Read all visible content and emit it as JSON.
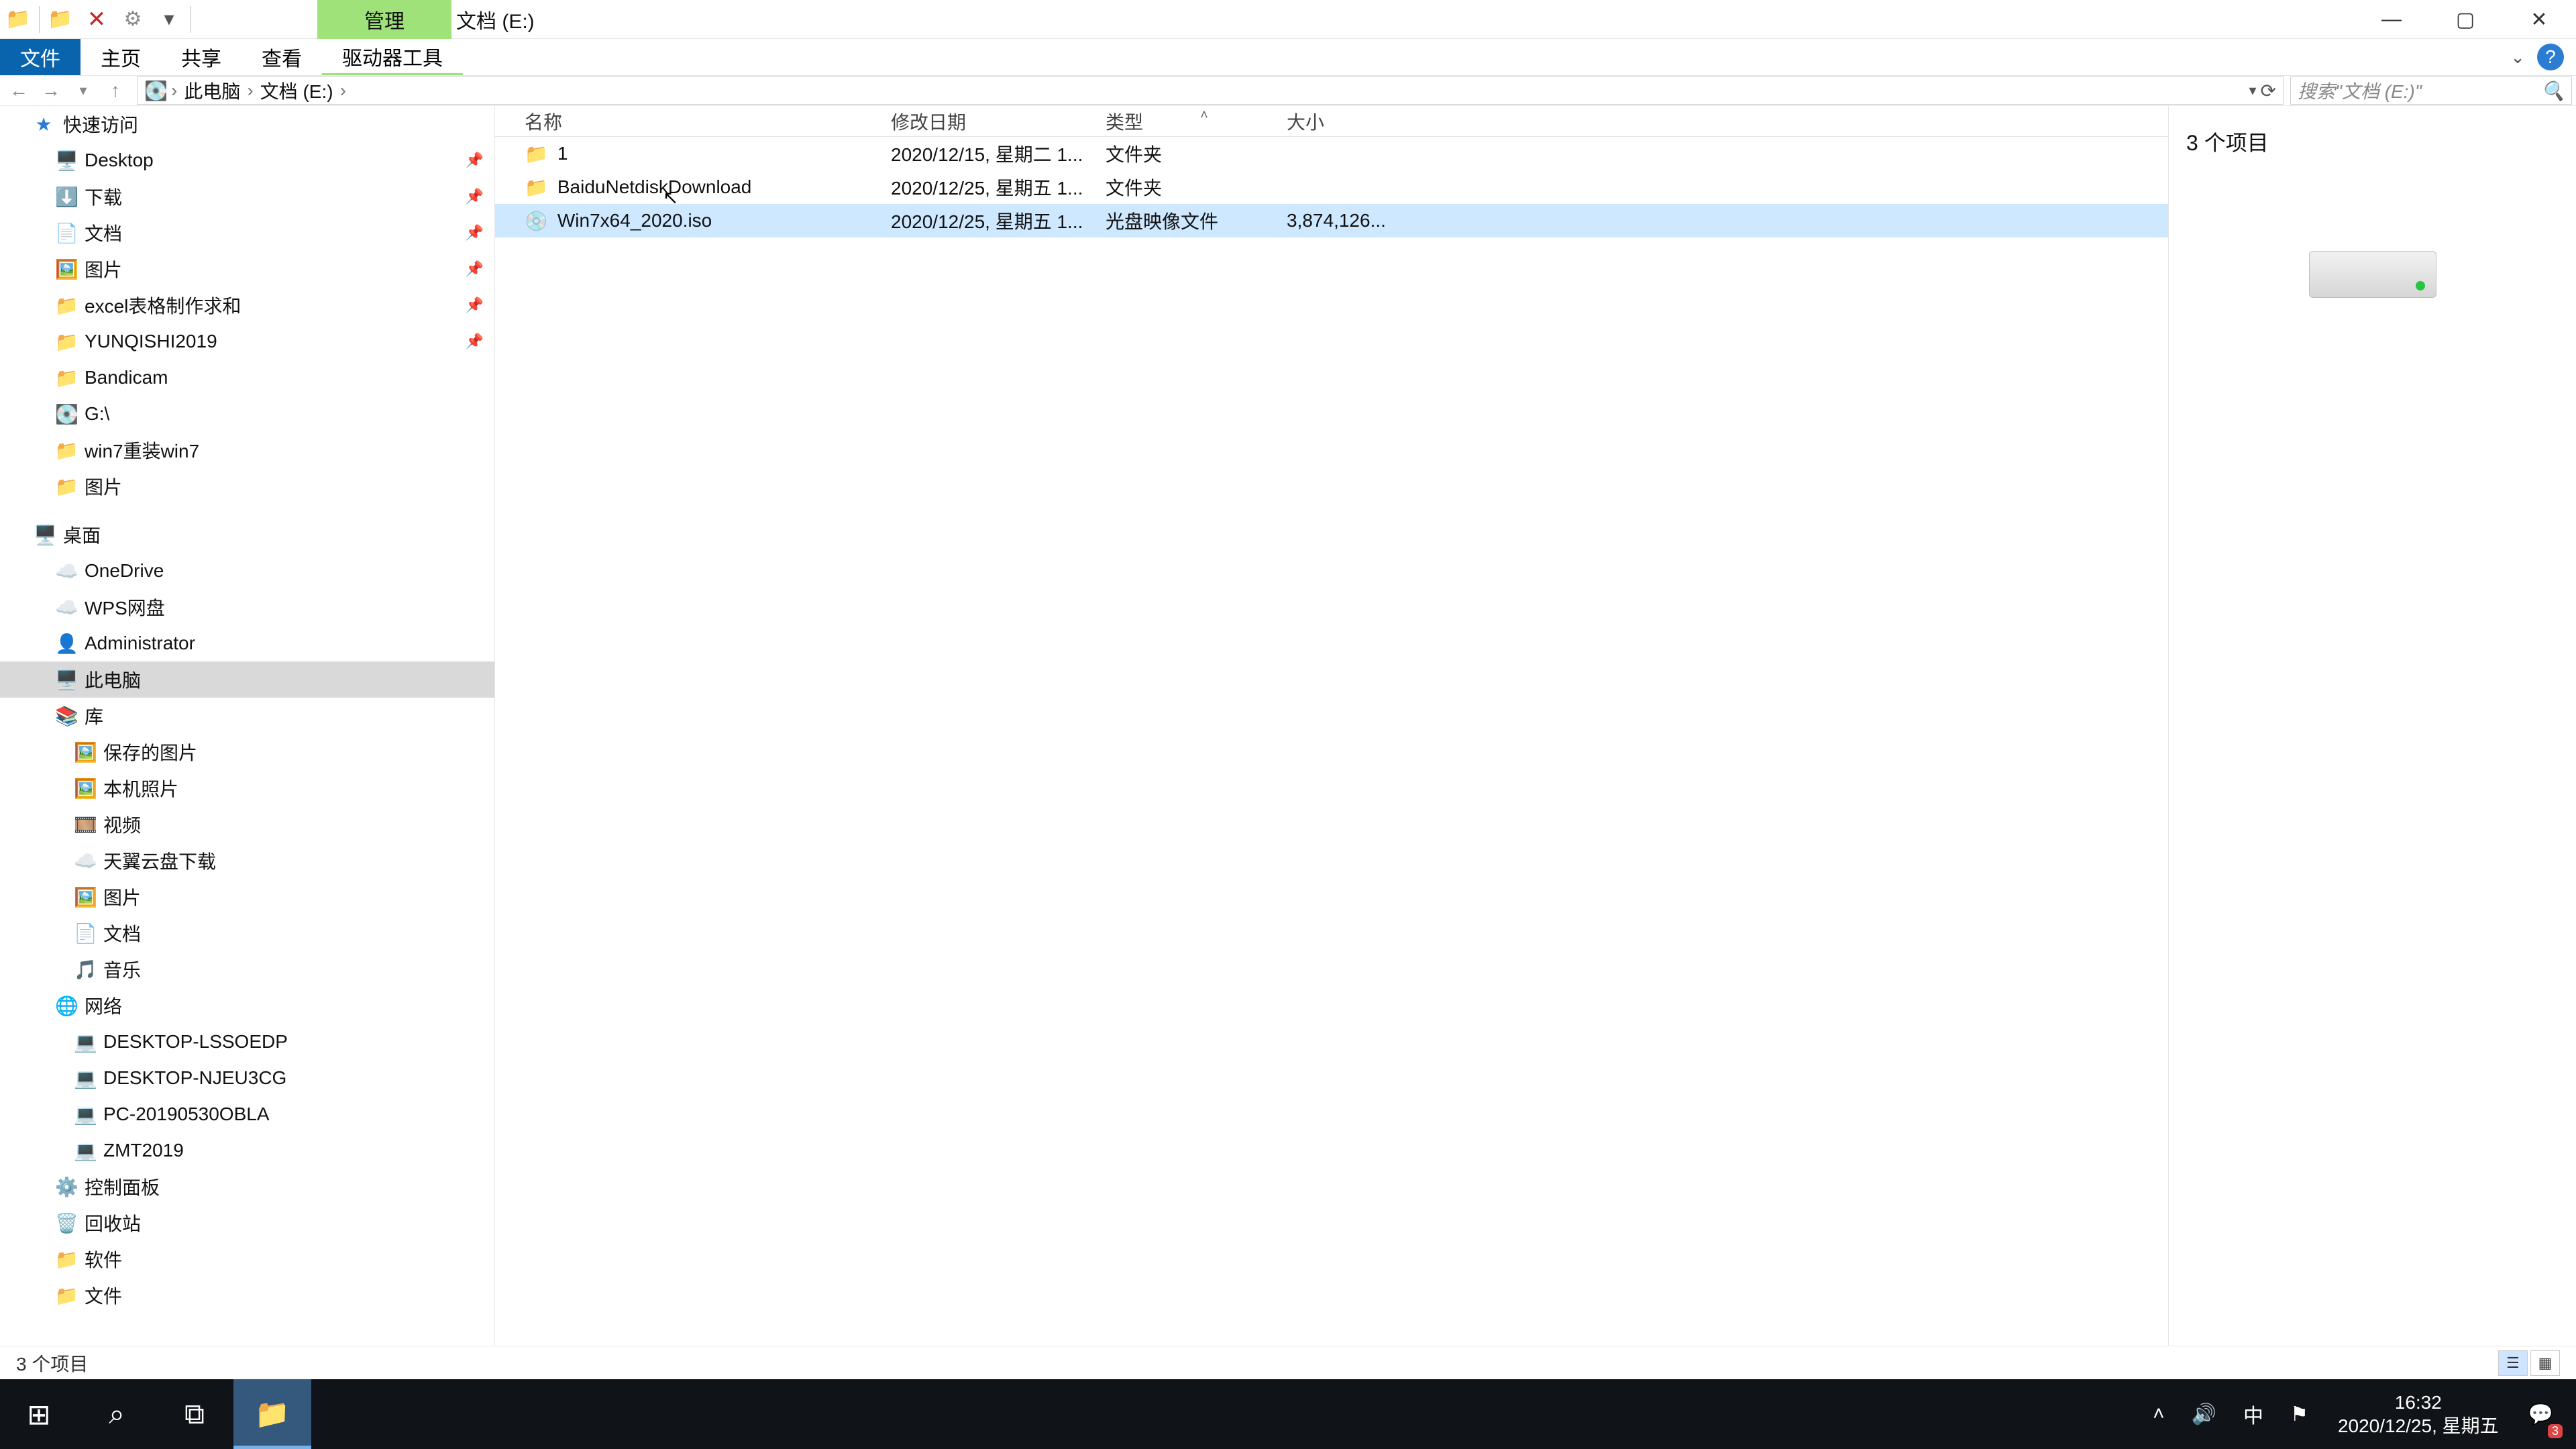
{
  "title": {
    "manage_tab": "管理",
    "location": "文档 (E:)"
  },
  "tabs": {
    "file": "文件",
    "home": "主页",
    "share": "共享",
    "view": "查看",
    "driver_tools": "驱动器工具"
  },
  "breadcrumb": {
    "root": "此电脑",
    "curr": "文档 (E:)"
  },
  "search_placeholder": "搜索\"文档 (E:)\"",
  "columns": {
    "name": "名称",
    "modified": "修改日期",
    "type": "类型",
    "size": "大小"
  },
  "files": [
    {
      "name": "1",
      "modified": "2020/12/15, 星期二 1...",
      "type": "文件夹",
      "size": "",
      "icon": "folder"
    },
    {
      "name": "BaiduNetdiskDownload",
      "modified": "2020/12/25, 星期五 1...",
      "type": "文件夹",
      "size": "",
      "icon": "folder"
    },
    {
      "name": "Win7x64_2020.iso",
      "modified": "2020/12/25, 星期五 1...",
      "type": "光盘映像文件",
      "size": "3,874,126...",
      "icon": "disc",
      "selected": true
    }
  ],
  "details": {
    "summary": "3 个项目"
  },
  "status": {
    "items": "3 个项目"
  },
  "nav": {
    "quick_access": "快速访问",
    "qa": [
      {
        "label": "Desktop",
        "icon": "🖥️",
        "pin": true
      },
      {
        "label": "下载",
        "icon": "⬇️",
        "pin": true
      },
      {
        "label": "文档",
        "icon": "📄",
        "pin": true
      },
      {
        "label": "图片",
        "icon": "🖼️",
        "pin": true
      },
      {
        "label": "excel表格制作求和",
        "icon": "📁",
        "pin": true
      },
      {
        "label": "YUNQISHI2019",
        "icon": "📁",
        "pin": true
      },
      {
        "label": "Bandicam",
        "icon": "📁",
        "pin": false
      },
      {
        "label": "G:\\",
        "icon": "💽",
        "pin": false
      },
      {
        "label": "win7重装win7",
        "icon": "📁",
        "pin": false
      },
      {
        "label": "图片",
        "icon": "📁",
        "pin": false
      }
    ],
    "desktop_label": "桌面",
    "desktop": [
      {
        "label": "OneDrive",
        "icon": "☁️"
      },
      {
        "label": "WPS网盘",
        "icon": "☁️"
      },
      {
        "label": "Administrator",
        "icon": "👤"
      },
      {
        "label": "此电脑",
        "icon": "🖥️",
        "active": true
      },
      {
        "label": "库",
        "icon": "📚"
      }
    ],
    "libs": [
      {
        "label": "保存的图片",
        "icon": "🖼️"
      },
      {
        "label": "本机照片",
        "icon": "🖼️"
      },
      {
        "label": "视频",
        "icon": "🎞️"
      },
      {
        "label": "天翼云盘下载",
        "icon": "☁️"
      },
      {
        "label": "图片",
        "icon": "🖼️"
      },
      {
        "label": "文档",
        "icon": "📄"
      },
      {
        "label": "音乐",
        "icon": "🎵"
      }
    ],
    "network_label": "网络",
    "net": [
      {
        "label": "DESKTOP-LSSOEDP",
        "icon": "💻"
      },
      {
        "label": "DESKTOP-NJEU3CG",
        "icon": "💻"
      },
      {
        "label": "PC-20190530OBLA",
        "icon": "💻"
      },
      {
        "label": "ZMT2019",
        "icon": "💻"
      }
    ],
    "extra": [
      {
        "label": "控制面板",
        "icon": "⚙️"
      },
      {
        "label": "回收站",
        "icon": "🗑️"
      },
      {
        "label": "软件",
        "icon": "📁"
      },
      {
        "label": "文件",
        "icon": "📁"
      }
    ]
  },
  "tray": {
    "ime": "中",
    "time": "16:32",
    "date": "2020/12/25, 星期五",
    "ac_badge": "3"
  }
}
